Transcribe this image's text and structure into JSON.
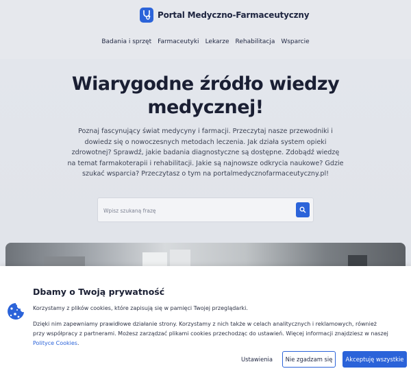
{
  "header": {
    "brand_name": "Portal Medyczno-Farmaceutyczny",
    "logo_icon": "stethoscope-icon",
    "nav": [
      {
        "label": "Badania i sprzęt"
      },
      {
        "label": "Farmaceutyki"
      },
      {
        "label": "Lekarze"
      },
      {
        "label": "Rehabilitacja"
      },
      {
        "label": "Wsparcie"
      }
    ]
  },
  "hero": {
    "title": "Wiarygodne źródło wiedzy medycznej!",
    "description": "Poznaj fascynujący świat medycyny i farmacji. Przeczytaj nasze przewodniki i dowiedz się o nowoczesnych metodach leczenia. Jak działa system opieki zdrowotnej? Sprawdź, jakie badania diagnostyczne są dostępne. Zdobądź wiedzę na temat farmakoterapii i rehabilitacji. Jakie są najnowsze odkrycia naukowe? Gdzie szukać wsparcia? Przeczytasz o tym na portalmedycznofarmaceutyczny.pl!",
    "search": {
      "placeholder": "Wpisz szukaną frazę",
      "button_icon": "search-icon"
    }
  },
  "cookie_banner": {
    "title": "Dbamy o Twoją prywatność",
    "text1": "Korzystamy z plików cookies, które zapisują się w pamięci Twojej przeglądarki.",
    "text2": "Dzięki nim zapewniamy prawidłowe działanie strony. Korzystamy z nich także w celach analitycznych i reklamowych, również przy współpracy z partnerami. Możesz zarządzać plikami cookies przechodząc do ustawień. Więcej informacji znajdziesz w naszej",
    "link": "Polityce Cookies",
    "text2_end": ".",
    "icon": "cookie-icon",
    "buttons": {
      "settings": "Ustawienia",
      "reject": "Nie zgadzam się",
      "accept": "Akceptuję wszystkie"
    }
  },
  "colors": {
    "accent": "#2b63d9",
    "background": "#e6e8ed",
    "banner": "#ffffff"
  }
}
